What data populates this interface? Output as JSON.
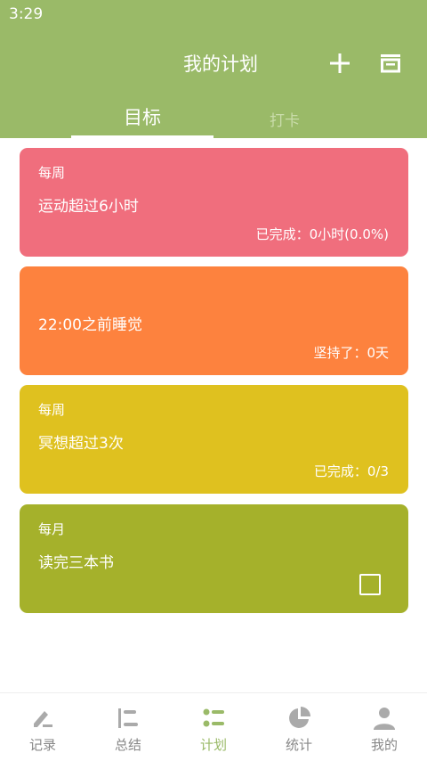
{
  "status_bar": {
    "time": "3:29"
  },
  "header": {
    "title": "我的计划",
    "tabs": [
      {
        "label": "目标",
        "active": true
      },
      {
        "label": "打卡",
        "active": false
      }
    ]
  },
  "plans": [
    {
      "period": "每周",
      "name": "运动超过6小时",
      "progress": "已完成：0小时(0.0%)",
      "color": "#f06e7d"
    },
    {
      "period": "",
      "name": "22:00之前睡觉",
      "progress": "坚持了：0天",
      "color": "#fd823e"
    },
    {
      "period": "每周",
      "name": "冥想超过3次",
      "progress": "已完成：0/3",
      "color": "#dfc11f"
    },
    {
      "period": "每月",
      "name": "读完三本书",
      "progress": "",
      "color": "#a5b12b",
      "checkbox": true
    }
  ],
  "bottom_nav": [
    {
      "label": "记录",
      "icon": "pen-icon"
    },
    {
      "label": "总结",
      "icon": "summary-icon"
    },
    {
      "label": "计划",
      "icon": "list-icon",
      "active": true
    },
    {
      "label": "统计",
      "icon": "pie-chart-icon"
    },
    {
      "label": "我的",
      "icon": "person-icon"
    }
  ],
  "colors": {
    "accent": "#9aba68",
    "inactive": "#888888",
    "icon_inactive": "#aaaaaa"
  }
}
